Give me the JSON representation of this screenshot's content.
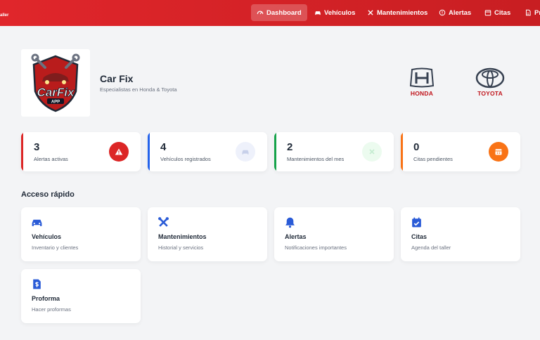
{
  "navbar": {
    "brand": "aller",
    "items": [
      {
        "label": "Dashboard",
        "icon": "gauge-icon"
      },
      {
        "label": "Vehículos",
        "icon": "car-icon"
      },
      {
        "label": "Mantenimientos",
        "icon": "tools-icon"
      },
      {
        "label": "Alertas",
        "icon": "alert-circle-icon"
      },
      {
        "label": "Citas",
        "icon": "calendar-icon"
      },
      {
        "label": "Pr",
        "icon": "document-icon"
      }
    ],
    "active": "Dashboard"
  },
  "header": {
    "logo_text": "CarFix",
    "logo_badge": "APP",
    "title": "Car Fix",
    "subtitle": "Especialistas en Honda & Toyota",
    "brands": [
      "HONDA",
      "TOYOTA"
    ]
  },
  "stats": [
    {
      "value": "3",
      "label": "Alertas activas",
      "color": "#dc2626",
      "icon": "warning-icon"
    },
    {
      "value": "4",
      "label": "Vehículos registrados",
      "color": "#2563eb",
      "icon": "car-icon"
    },
    {
      "value": "2",
      "label": "Mantenimientos del mes",
      "color": "#16a34a",
      "icon": "tools-icon"
    },
    {
      "value": "0",
      "label": "Citas pendientes",
      "color": "#f97316",
      "icon": "calendar-icon"
    }
  ],
  "quick_access": {
    "title": "Acceso rápido",
    "cards": [
      {
        "title": "Vehículos",
        "desc": "Inventario y clientes",
        "icon": "car-icon"
      },
      {
        "title": "Mantenimientos",
        "desc": "Historial y servicios",
        "icon": "tools-icon"
      },
      {
        "title": "Alertas",
        "desc": "Notificaciones importantes",
        "icon": "bell-icon"
      },
      {
        "title": "Citas",
        "desc": "Agenda del taller",
        "icon": "calendar-check-icon"
      },
      {
        "title": "Proforma",
        "desc": "Hacer proformas",
        "icon": "invoice-icon"
      }
    ]
  },
  "colors": {
    "nav": "#d9232a",
    "accent_blue": "#2a5bd7"
  }
}
